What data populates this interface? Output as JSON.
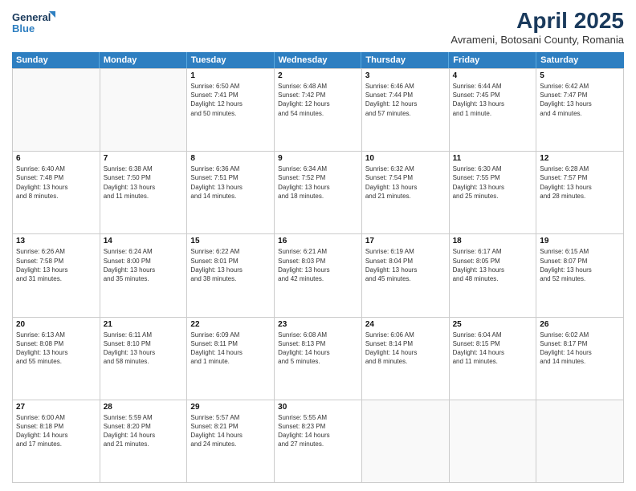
{
  "header": {
    "logo_line1": "General",
    "logo_line2": "Blue",
    "month": "April 2025",
    "location": "Avrameni, Botosani County, Romania"
  },
  "days_of_week": [
    "Sunday",
    "Monday",
    "Tuesday",
    "Wednesday",
    "Thursday",
    "Friday",
    "Saturday"
  ],
  "weeks": [
    [
      {
        "day": "",
        "info": ""
      },
      {
        "day": "",
        "info": ""
      },
      {
        "day": "1",
        "info": "Sunrise: 6:50 AM\nSunset: 7:41 PM\nDaylight: 12 hours\nand 50 minutes."
      },
      {
        "day": "2",
        "info": "Sunrise: 6:48 AM\nSunset: 7:42 PM\nDaylight: 12 hours\nand 54 minutes."
      },
      {
        "day": "3",
        "info": "Sunrise: 6:46 AM\nSunset: 7:44 PM\nDaylight: 12 hours\nand 57 minutes."
      },
      {
        "day": "4",
        "info": "Sunrise: 6:44 AM\nSunset: 7:45 PM\nDaylight: 13 hours\nand 1 minute."
      },
      {
        "day": "5",
        "info": "Sunrise: 6:42 AM\nSunset: 7:47 PM\nDaylight: 13 hours\nand 4 minutes."
      }
    ],
    [
      {
        "day": "6",
        "info": "Sunrise: 6:40 AM\nSunset: 7:48 PM\nDaylight: 13 hours\nand 8 minutes."
      },
      {
        "day": "7",
        "info": "Sunrise: 6:38 AM\nSunset: 7:50 PM\nDaylight: 13 hours\nand 11 minutes."
      },
      {
        "day": "8",
        "info": "Sunrise: 6:36 AM\nSunset: 7:51 PM\nDaylight: 13 hours\nand 14 minutes."
      },
      {
        "day": "9",
        "info": "Sunrise: 6:34 AM\nSunset: 7:52 PM\nDaylight: 13 hours\nand 18 minutes."
      },
      {
        "day": "10",
        "info": "Sunrise: 6:32 AM\nSunset: 7:54 PM\nDaylight: 13 hours\nand 21 minutes."
      },
      {
        "day": "11",
        "info": "Sunrise: 6:30 AM\nSunset: 7:55 PM\nDaylight: 13 hours\nand 25 minutes."
      },
      {
        "day": "12",
        "info": "Sunrise: 6:28 AM\nSunset: 7:57 PM\nDaylight: 13 hours\nand 28 minutes."
      }
    ],
    [
      {
        "day": "13",
        "info": "Sunrise: 6:26 AM\nSunset: 7:58 PM\nDaylight: 13 hours\nand 31 minutes."
      },
      {
        "day": "14",
        "info": "Sunrise: 6:24 AM\nSunset: 8:00 PM\nDaylight: 13 hours\nand 35 minutes."
      },
      {
        "day": "15",
        "info": "Sunrise: 6:22 AM\nSunset: 8:01 PM\nDaylight: 13 hours\nand 38 minutes."
      },
      {
        "day": "16",
        "info": "Sunrise: 6:21 AM\nSunset: 8:03 PM\nDaylight: 13 hours\nand 42 minutes."
      },
      {
        "day": "17",
        "info": "Sunrise: 6:19 AM\nSunset: 8:04 PM\nDaylight: 13 hours\nand 45 minutes."
      },
      {
        "day": "18",
        "info": "Sunrise: 6:17 AM\nSunset: 8:05 PM\nDaylight: 13 hours\nand 48 minutes."
      },
      {
        "day": "19",
        "info": "Sunrise: 6:15 AM\nSunset: 8:07 PM\nDaylight: 13 hours\nand 52 minutes."
      }
    ],
    [
      {
        "day": "20",
        "info": "Sunrise: 6:13 AM\nSunset: 8:08 PM\nDaylight: 13 hours\nand 55 minutes."
      },
      {
        "day": "21",
        "info": "Sunrise: 6:11 AM\nSunset: 8:10 PM\nDaylight: 13 hours\nand 58 minutes."
      },
      {
        "day": "22",
        "info": "Sunrise: 6:09 AM\nSunset: 8:11 PM\nDaylight: 14 hours\nand 1 minute."
      },
      {
        "day": "23",
        "info": "Sunrise: 6:08 AM\nSunset: 8:13 PM\nDaylight: 14 hours\nand 5 minutes."
      },
      {
        "day": "24",
        "info": "Sunrise: 6:06 AM\nSunset: 8:14 PM\nDaylight: 14 hours\nand 8 minutes."
      },
      {
        "day": "25",
        "info": "Sunrise: 6:04 AM\nSunset: 8:15 PM\nDaylight: 14 hours\nand 11 minutes."
      },
      {
        "day": "26",
        "info": "Sunrise: 6:02 AM\nSunset: 8:17 PM\nDaylight: 14 hours\nand 14 minutes."
      }
    ],
    [
      {
        "day": "27",
        "info": "Sunrise: 6:00 AM\nSunset: 8:18 PM\nDaylight: 14 hours\nand 17 minutes."
      },
      {
        "day": "28",
        "info": "Sunrise: 5:59 AM\nSunset: 8:20 PM\nDaylight: 14 hours\nand 21 minutes."
      },
      {
        "day": "29",
        "info": "Sunrise: 5:57 AM\nSunset: 8:21 PM\nDaylight: 14 hours\nand 24 minutes."
      },
      {
        "day": "30",
        "info": "Sunrise: 5:55 AM\nSunset: 8:23 PM\nDaylight: 14 hours\nand 27 minutes."
      },
      {
        "day": "",
        "info": ""
      },
      {
        "day": "",
        "info": ""
      },
      {
        "day": "",
        "info": ""
      }
    ]
  ]
}
